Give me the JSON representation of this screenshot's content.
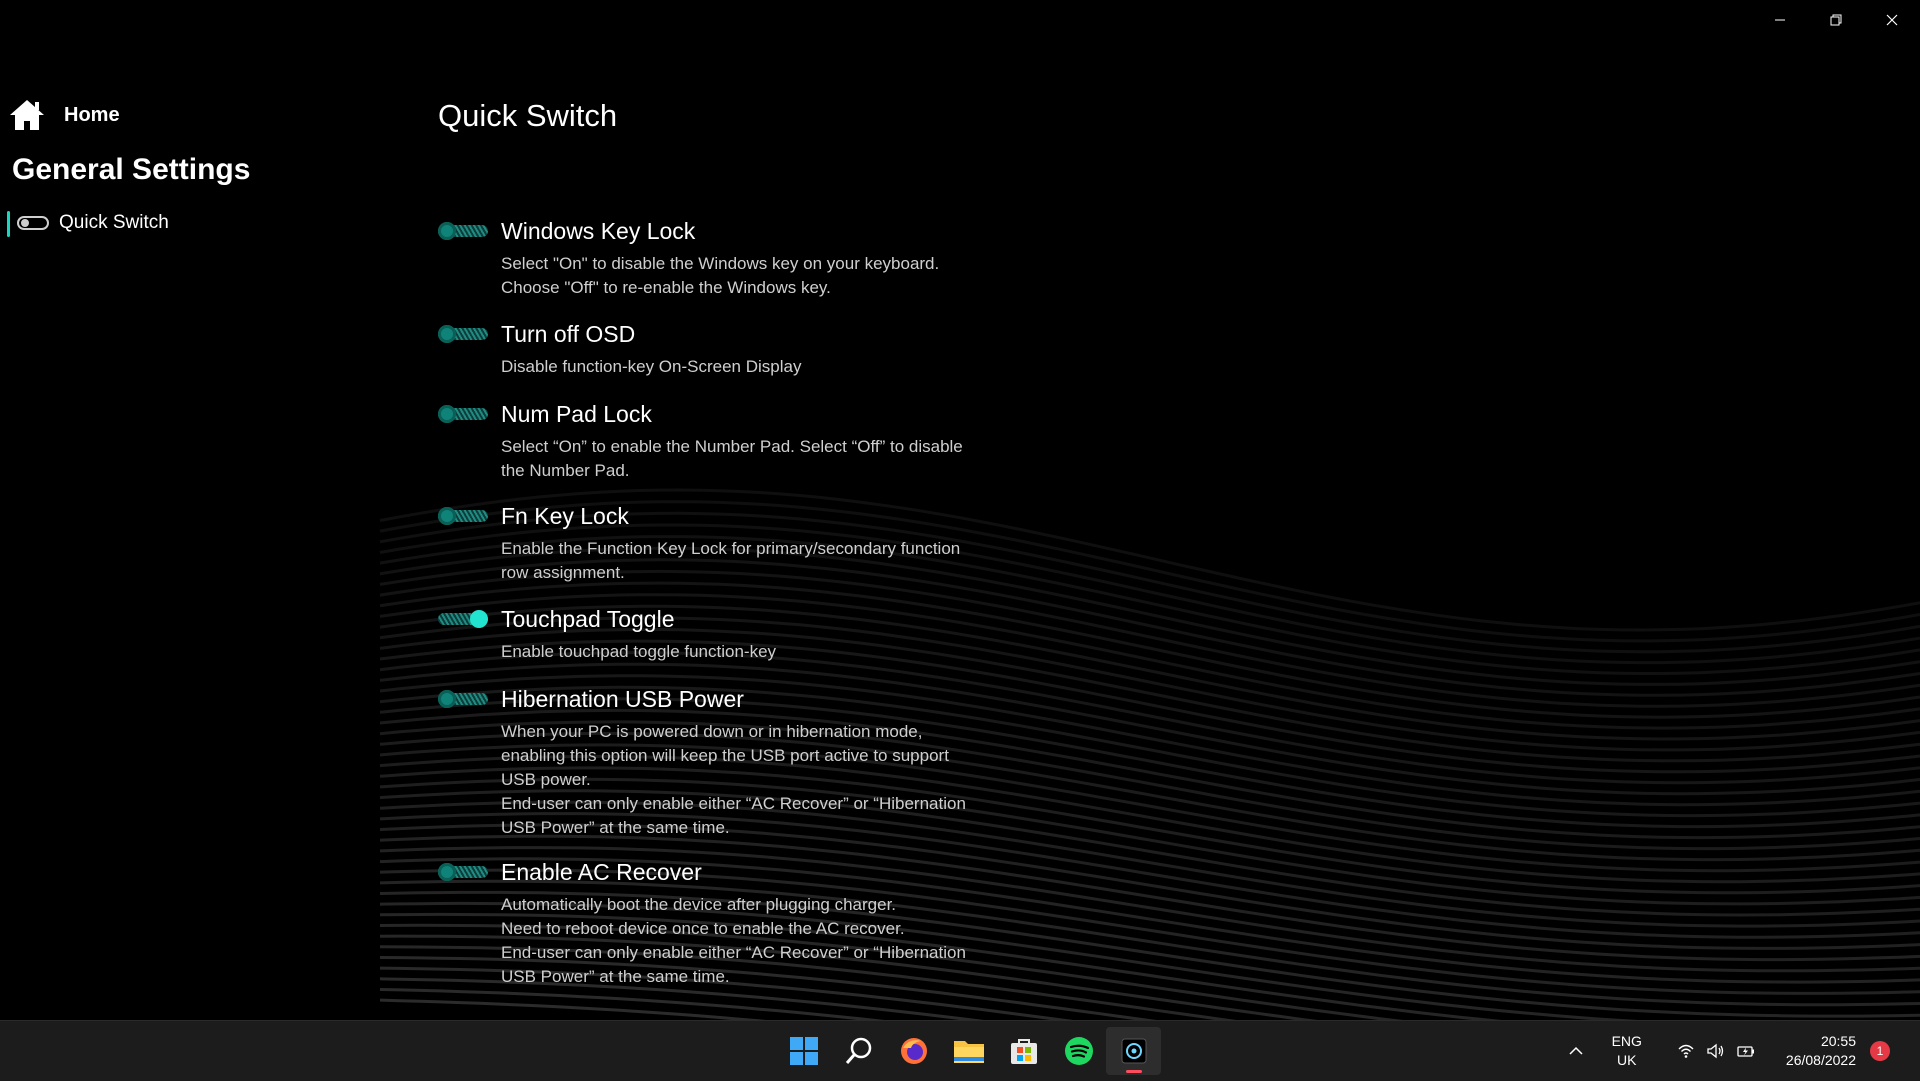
{
  "window": {
    "controls": [
      "minimize",
      "restore",
      "close"
    ]
  },
  "sidebar": {
    "home_label": "Home",
    "section_title": "General Settings",
    "items": [
      {
        "label": "Quick Switch",
        "icon": "toggle-icon",
        "selected": true
      }
    ]
  },
  "main": {
    "title": "Quick Switch",
    "options": [
      {
        "label": "Windows Key Lock",
        "state": "off",
        "description": "Select \"On\" to disable the Windows key on your keyboard.  Choose \"Off\" to re-enable the Windows key."
      },
      {
        "label": "Turn off OSD",
        "state": "off",
        "description": "Disable function-key On-Screen Display"
      },
      {
        "label": "Num Pad Lock",
        "state": "off",
        "description": "Select “On” to enable the Number Pad. Select “Off” to disable the Number Pad."
      },
      {
        "label": "Fn Key Lock",
        "state": "off",
        "description": "Enable the Function Key Lock for primary/secondary function row assignment."
      },
      {
        "label": "Touchpad Toggle",
        "state": "on",
        "description": "Enable touchpad toggle function-key"
      },
      {
        "label": "Hibernation USB Power",
        "state": "off",
        "description": "When your PC is powered down or in hibernation mode, enabling this option will keep the USB port active to support USB power.\nEnd-user can only enable either “AC Recover” or “Hibernation USB Power” at the same time."
      },
      {
        "label": "Enable AC Recover",
        "state": "off",
        "description": "Automatically boot the device after plugging charger.\nNeed to reboot device once to enable the AC recover.\nEnd-user can only enable either “AC Recover” or “Hibernation USB Power” at the same time."
      }
    ]
  },
  "taskbar": {
    "apps": [
      "windows-start-icon",
      "search-icon",
      "firefox-icon",
      "file-explorer-icon",
      "microsoft-store-icon",
      "spotify-icon",
      "control-center-icon"
    ],
    "language": {
      "line1": "ENG",
      "line2": "UK"
    },
    "time": "20:55",
    "date": "26/08/2022",
    "notifications": "1",
    "colors": {
      "accent": "#21e3cf",
      "notification": "#e53a45",
      "spotify": "#1ed760"
    }
  }
}
